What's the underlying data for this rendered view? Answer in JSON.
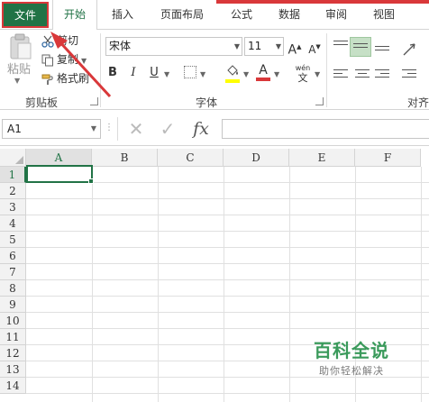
{
  "tabs": {
    "file": "文件",
    "home": "开始",
    "insert": "插入",
    "page_layout": "页面布局",
    "formulas": "公式",
    "data": "数据",
    "review": "审阅",
    "view": "视图"
  },
  "clipboard": {
    "paste": "粘贴",
    "cut": "剪切",
    "copy": "复制",
    "format_painter": "格式刷",
    "group_label": "剪贴板"
  },
  "font": {
    "name": "宋体",
    "size": "11",
    "grow": "A",
    "shrink": "A",
    "bold": "B",
    "italic": "I",
    "underline": "U",
    "phonetic_top": "wén",
    "phonetic_bottom": "文",
    "font_color_letter": "A",
    "group_label": "字体"
  },
  "alignment": {
    "group_label": "对齐"
  },
  "formula_bar": {
    "name_box": "A1",
    "cancel": "✕",
    "enter": "✓",
    "fx": "fx",
    "value": ""
  },
  "grid": {
    "columns": [
      "A",
      "B",
      "C",
      "D",
      "E",
      "F"
    ],
    "rows": [
      "1",
      "2",
      "3",
      "4",
      "5",
      "6",
      "7",
      "8",
      "9",
      "10",
      "11",
      "12",
      "13",
      "14"
    ],
    "selected_cell": "A1"
  },
  "watermark": {
    "title": "百科全说",
    "subtitle": "助你轻松解决"
  },
  "colors": {
    "excel_green": "#217346",
    "highlight_red": "#d9383a",
    "font_color_red": "#d9383a",
    "fill_yellow": "#ffff00"
  }
}
